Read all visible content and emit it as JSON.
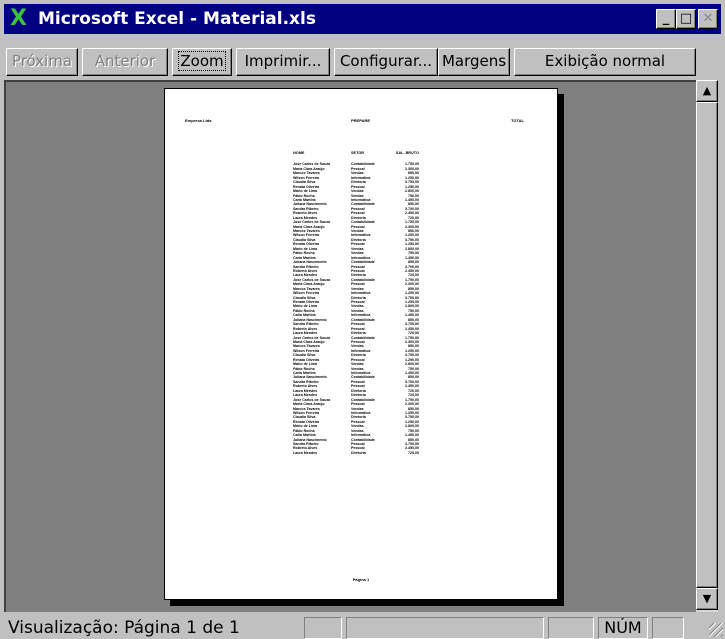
{
  "window": {
    "title": "Microsoft Excel - Material.xls",
    "icon": "excel-x-icon",
    "titlebar_color": "#000080"
  },
  "toolbar": {
    "next": "Próxima",
    "previous": "Anterior",
    "zoom": "Zoom",
    "print": "Imprimir...",
    "setup": "Configurar...",
    "margins": "Margens",
    "normal_view": "Exibição normal"
  },
  "page": {
    "header_left": "Empresa Ltda",
    "header_center": "PREPARE",
    "header_right": "TOTAL",
    "columns": [
      "NOME",
      "SETOR",
      "SAL. BRUTO"
    ],
    "rows": [
      [
        "Jose Carlos de Souza",
        "Contabilidade",
        "1.750,00"
      ],
      [
        "Maria Clara Araújo",
        "Pessoal",
        "2.300,00"
      ],
      [
        "Marcos Tavares",
        "Vendas",
        "850,00"
      ],
      [
        "Wilson Ferreira",
        "Informática",
        "1.250,00"
      ],
      [
        "Claudia Silva",
        "Diretoria",
        "3.750,00"
      ],
      [
        "Renata Oliveira",
        "Pessoal",
        "1.250,00"
      ],
      [
        "Mário de Lima",
        "Vendas",
        "2.800,00"
      ],
      [
        "Fábio Rocha",
        "Vendas",
        "750,00"
      ],
      [
        "Carla Martins",
        "Informática",
        "1.450,00"
      ],
      [
        "Juliana Nascimento",
        "Contabilidade",
        "850,00"
      ],
      [
        "Sandra Ribeiro",
        "Pessoal",
        "3.700,00"
      ],
      [
        "Roberto Alves",
        "Pessoal",
        "2.450,00"
      ],
      [
        "Laura Mendes",
        "Diretoria",
        "720,00"
      ],
      [
        "Jose Carlos de Souza",
        "Contabilidade",
        "1.750,00"
      ],
      [
        "Maria Clara Araújo",
        "Pessoal",
        "2.300,00"
      ],
      [
        "Marcos Tavares",
        "Vendas",
        "850,00"
      ],
      [
        "Wilson Ferreira",
        "Informática",
        "1.250,00"
      ],
      [
        "Claudia Silva",
        "Diretoria",
        "3.750,00"
      ],
      [
        "Renata Oliveira",
        "Pessoal",
        "1.250,00"
      ],
      [
        "Mário de Lima",
        "Vendas",
        "2.800,00"
      ],
      [
        "Fábio Rocha",
        "Vendas",
        "750,00"
      ],
      [
        "Carla Martins",
        "Informática",
        "1.450,00"
      ],
      [
        "Juliana Nascimento",
        "Contabilidade",
        "850,00"
      ],
      [
        "Sandra Ribeiro",
        "Pessoal",
        "3.700,00"
      ],
      [
        "Roberto Alves",
        "Pessoal",
        "2.450,00"
      ],
      [
        "Laura Mendes",
        "Diretoria",
        "720,00"
      ],
      [
        "Jose Carlos de Souza",
        "Contabilidade",
        "1.750,00"
      ],
      [
        "Maria Clara Araújo",
        "Pessoal",
        "2.300,00"
      ],
      [
        "Marcos Tavares",
        "Vendas",
        "850,00"
      ],
      [
        "Wilson Ferreira",
        "Informática",
        "1.250,00"
      ],
      [
        "Claudia Silva",
        "Diretoria",
        "3.750,00"
      ],
      [
        "Renata Oliveira",
        "Pessoal",
        "1.250,00"
      ],
      [
        "Mário de Lima",
        "Vendas",
        "2.800,00"
      ],
      [
        "Fábio Rocha",
        "Vendas",
        "750,00"
      ],
      [
        "Carla Martins",
        "Informática",
        "1.450,00"
      ],
      [
        "Juliana Nascimento",
        "Contabilidade",
        "850,00"
      ],
      [
        "Sandra Ribeiro",
        "Pessoal",
        "3.700,00"
      ],
      [
        "Roberto Alves",
        "Pessoal",
        "2.450,00"
      ],
      [
        "Laura Mendes",
        "Diretoria",
        "720,00"
      ],
      [
        "Jose Carlos de Souza",
        "Contabilidade",
        "1.750,00"
      ],
      [
        "Maria Clara Araújo",
        "Pessoal",
        "2.300,00"
      ],
      [
        "Marcos Tavares",
        "Vendas",
        "850,00"
      ],
      [
        "Wilson Ferreira",
        "Informática",
        "1.250,00"
      ],
      [
        "Claudia Silva",
        "Diretoria",
        "3.750,00"
      ],
      [
        "Renata Oliveira",
        "Pessoal",
        "1.250,00"
      ],
      [
        "Mário de Lima",
        "Vendas",
        "2.800,00"
      ],
      [
        "Fábio Rocha",
        "Vendas",
        "750,00"
      ],
      [
        "Carla Martins",
        "Informática",
        "1.450,00"
      ],
      [
        "Juliana Nascimento",
        "Contabilidade",
        "850,00"
      ],
      [
        "Sandra Ribeiro",
        "Pessoal",
        "3.700,00"
      ],
      [
        "Roberto Alves",
        "Pessoal",
        "2.450,00"
      ],
      [
        "Laura Mendes",
        "Diretoria",
        "720,00"
      ],
      [
        "Laura Mendes",
        "Diretoria",
        "720,00"
      ],
      [
        "Jose Carlos de Souza",
        "Contabilidade",
        "1.750,00"
      ],
      [
        "Maria Clara Araújo",
        "Pessoal",
        "2.300,00"
      ],
      [
        "Marcos Tavares",
        "Vendas",
        "850,00"
      ],
      [
        "Wilson Ferreira",
        "Informática",
        "1.250,00"
      ],
      [
        "Claudia Silva",
        "Diretoria",
        "3.750,00"
      ],
      [
        "Renata Oliveira",
        "Pessoal",
        "1.250,00"
      ],
      [
        "Mário de Lima",
        "Vendas",
        "2.800,00"
      ],
      [
        "Fábio Rocha",
        "Vendas",
        "750,00"
      ],
      [
        "Carla Martins",
        "Informática",
        "1.450,00"
      ],
      [
        "Juliana Nascimento",
        "Contabilidade",
        "850,00"
      ],
      [
        "Sandra Ribeiro",
        "Pessoal",
        "3.700,00"
      ],
      [
        "Roberto Alves",
        "Pessoal",
        "2.450,00"
      ],
      [
        "Laura Mendes",
        "Diretoria",
        "720,00"
      ]
    ],
    "footer": "Página 1"
  },
  "status": {
    "text": "Visualização: Página 1 de 1",
    "num": "NÚM"
  }
}
